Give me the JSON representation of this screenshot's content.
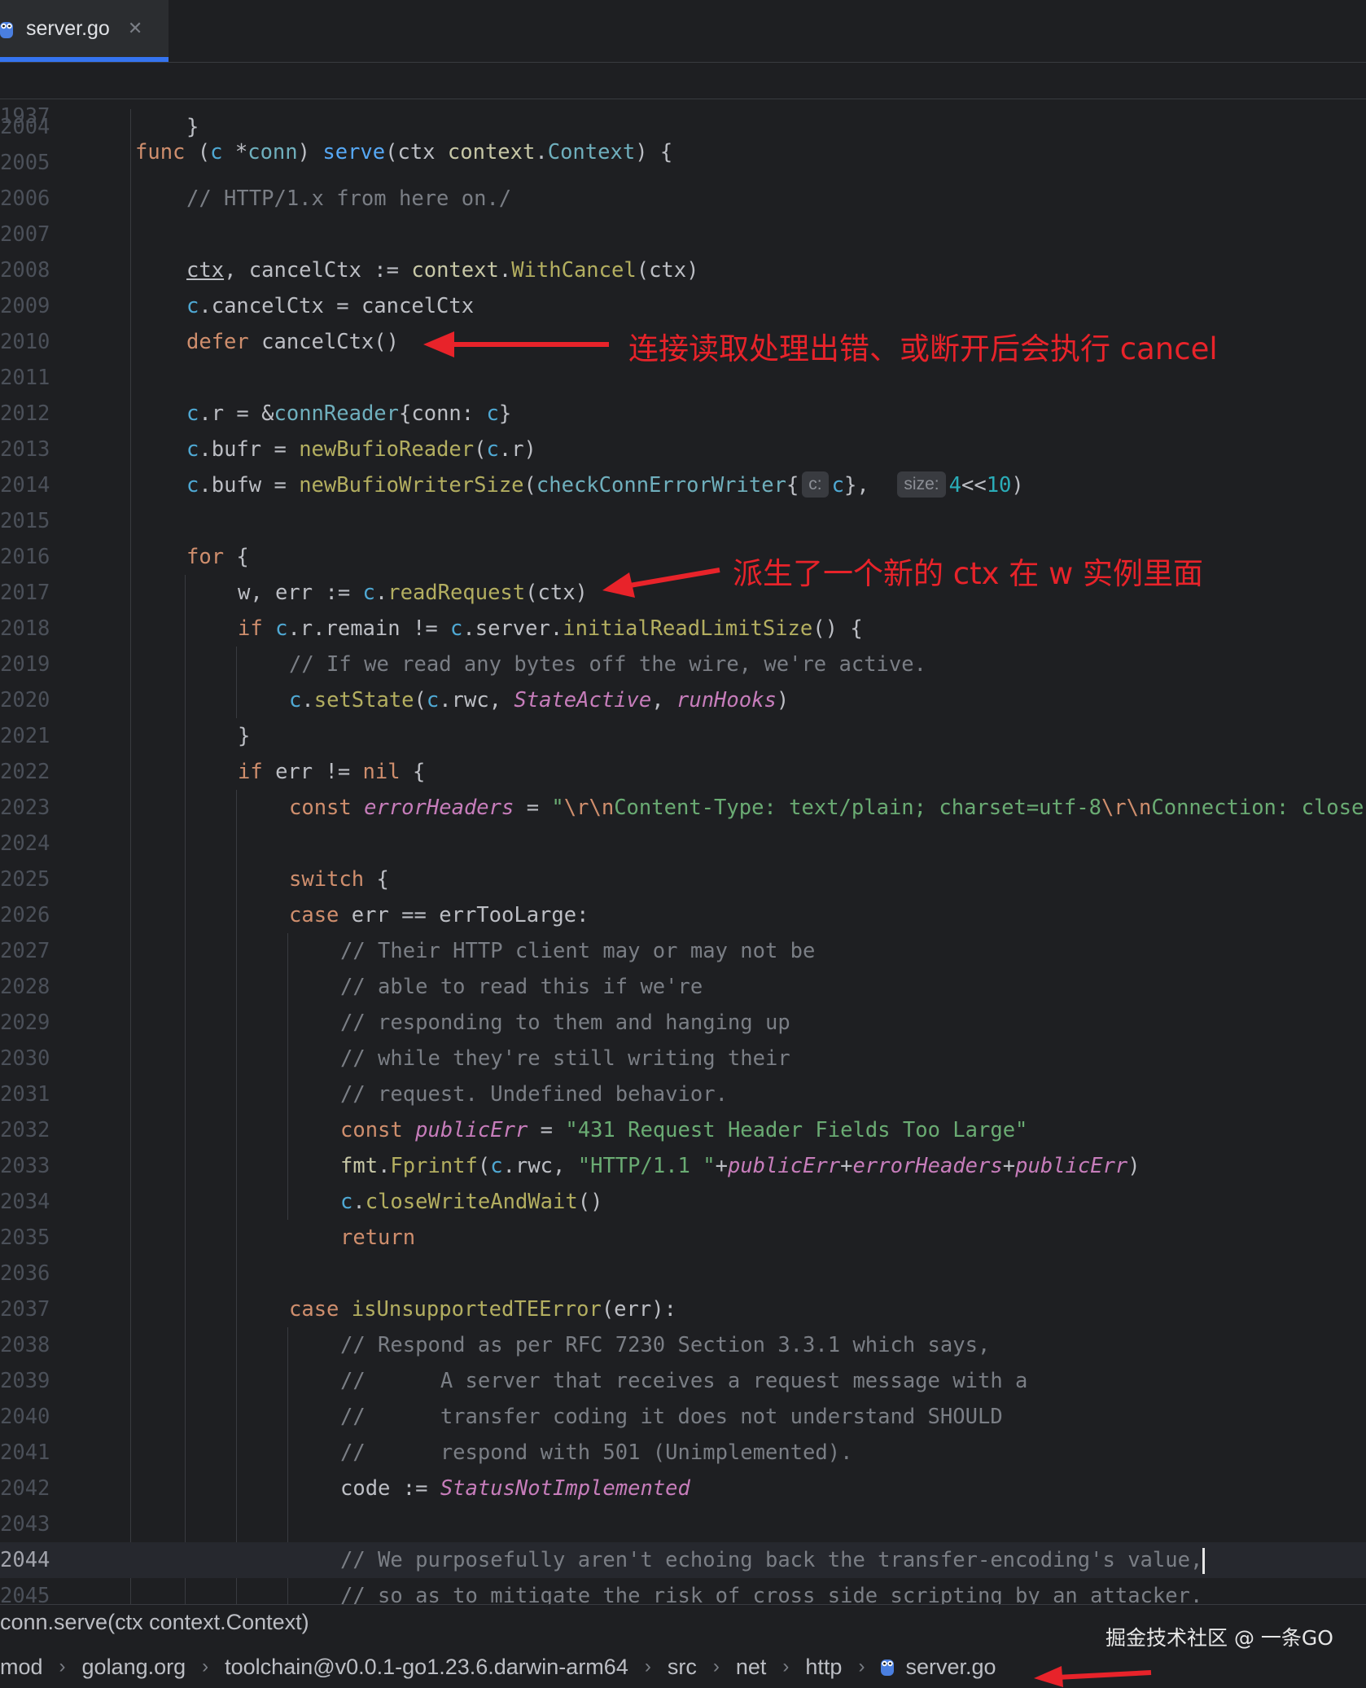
{
  "tab": {
    "label": "server.go",
    "close": "✕",
    "icon": "gopher-icon"
  },
  "sticky": {
    "line_number": "1937",
    "tokens": [
      {
        "t": "func",
        "c": "kw"
      },
      {
        "t": " (",
        "c": "typ"
      },
      {
        "t": "c",
        "c": "rcv"
      },
      {
        "t": " *",
        "c": "typ"
      },
      {
        "t": "conn",
        "c": "typn"
      },
      {
        "t": ") ",
        "c": "typ"
      },
      {
        "t": "serve",
        "c": "fn"
      },
      {
        "t": "(ctx ",
        "c": "typ"
      },
      {
        "t": "context",
        "c": "pkg"
      },
      {
        "t": ".",
        "c": "typ"
      },
      {
        "t": "Context",
        "c": "typn"
      },
      {
        "t": ") {",
        "c": "typ"
      }
    ]
  },
  "code_lines": [
    {
      "n": "2004",
      "indent": 1,
      "tokens": [
        {
          "t": "}",
          "c": "typ"
        }
      ]
    },
    {
      "n": "2005",
      "indent": 1,
      "tokens": []
    },
    {
      "n": "2006",
      "indent": 1,
      "tokens": [
        {
          "t": "// HTTP/1.x from here on./",
          "c": "cm"
        }
      ]
    },
    {
      "n": "2007",
      "indent": 1,
      "tokens": []
    },
    {
      "n": "2008",
      "indent": 1,
      "tokens": [
        {
          "t": "ctx",
          "c": "typ under"
        },
        {
          "t": ", cancelCtx := ",
          "c": "typ"
        },
        {
          "t": "context",
          "c": "pkg"
        },
        {
          "t": ".",
          "c": "typ"
        },
        {
          "t": "WithCancel",
          "c": "call"
        },
        {
          "t": "(ctx)",
          "c": "typ"
        }
      ]
    },
    {
      "n": "2009",
      "indent": 1,
      "tokens": [
        {
          "t": "c",
          "c": "rcv"
        },
        {
          "t": ".cancelCtx = cancelCtx",
          "c": "typ"
        }
      ]
    },
    {
      "n": "2010",
      "indent": 1,
      "tokens": [
        {
          "t": "defer",
          "c": "kw"
        },
        {
          "t": " cancelCtx()",
          "c": "typ"
        }
      ]
    },
    {
      "n": "2011",
      "indent": 1,
      "tokens": []
    },
    {
      "n": "2012",
      "indent": 1,
      "tokens": [
        {
          "t": "c",
          "c": "rcv"
        },
        {
          "t": ".r = &",
          "c": "typ"
        },
        {
          "t": "connReader",
          "c": "typn"
        },
        {
          "t": "{conn: ",
          "c": "typ"
        },
        {
          "t": "c",
          "c": "rcv"
        },
        {
          "t": "}",
          "c": "typ"
        }
      ]
    },
    {
      "n": "2013",
      "indent": 1,
      "tokens": [
        {
          "t": "c",
          "c": "rcv"
        },
        {
          "t": ".bufr = ",
          "c": "typ"
        },
        {
          "t": "newBufioReader",
          "c": "call"
        },
        {
          "t": "(",
          "c": "typ"
        },
        {
          "t": "c",
          "c": "rcv"
        },
        {
          "t": ".r)",
          "c": "typ"
        }
      ]
    },
    {
      "n": "2014",
      "indent": 1,
      "tokens": [
        {
          "t": "c",
          "c": "rcv"
        },
        {
          "t": ".bufw = ",
          "c": "typ"
        },
        {
          "t": "newBufioWriterSize",
          "c": "call"
        },
        {
          "t": "(",
          "c": "typ"
        },
        {
          "t": "checkConnErrorWriter",
          "c": "typn"
        },
        {
          "t": "{",
          "c": "typ"
        },
        {
          "t": "c:",
          "c": "hint"
        },
        {
          "t": "c",
          "c": "rcv"
        },
        {
          "t": "},  ",
          "c": "typ"
        },
        {
          "t": "size:",
          "c": "hint"
        },
        {
          "t": "4",
          "c": "num"
        },
        {
          "t": "<<",
          "c": "typ"
        },
        {
          "t": "10",
          "c": "num"
        },
        {
          "t": ")",
          "c": "typ"
        }
      ]
    },
    {
      "n": "2015",
      "indent": 1,
      "tokens": []
    },
    {
      "n": "2016",
      "indent": 1,
      "tokens": [
        {
          "t": "for",
          "c": "kw"
        },
        {
          "t": " {",
          "c": "typ"
        }
      ]
    },
    {
      "n": "2017",
      "indent": 2,
      "tokens": [
        {
          "t": "w, err := ",
          "c": "typ"
        },
        {
          "t": "c",
          "c": "rcv"
        },
        {
          "t": ".",
          "c": "typ"
        },
        {
          "t": "readRequest",
          "c": "call"
        },
        {
          "t": "(ctx)",
          "c": "typ"
        }
      ]
    },
    {
      "n": "2018",
      "indent": 2,
      "tokens": [
        {
          "t": "if",
          "c": "kw"
        },
        {
          "t": " ",
          "c": "typ"
        },
        {
          "t": "c",
          "c": "rcv"
        },
        {
          "t": ".r.remain != ",
          "c": "typ"
        },
        {
          "t": "c",
          "c": "rcv"
        },
        {
          "t": ".server.",
          "c": "typ"
        },
        {
          "t": "initialReadLimitSize",
          "c": "call"
        },
        {
          "t": "() {",
          "c": "typ"
        }
      ]
    },
    {
      "n": "2019",
      "indent": 3,
      "tokens": [
        {
          "t": "// If we read any bytes off the wire, we're active.",
          "c": "cm"
        }
      ]
    },
    {
      "n": "2020",
      "indent": 3,
      "tokens": [
        {
          "t": "c",
          "c": "rcv"
        },
        {
          "t": ".",
          "c": "typ"
        },
        {
          "t": "setState",
          "c": "call"
        },
        {
          "t": "(",
          "c": "typ"
        },
        {
          "t": "c",
          "c": "rcv"
        },
        {
          "t": ".rwc, ",
          "c": "typ"
        },
        {
          "t": "StateActive",
          "c": "it"
        },
        {
          "t": ", ",
          "c": "typ"
        },
        {
          "t": "runHooks",
          "c": "it"
        },
        {
          "t": ")",
          "c": "typ"
        }
      ]
    },
    {
      "n": "2021",
      "indent": 2,
      "tokens": [
        {
          "t": "}",
          "c": "typ"
        }
      ]
    },
    {
      "n": "2022",
      "indent": 2,
      "tokens": [
        {
          "t": "if",
          "c": "kw"
        },
        {
          "t": " err != ",
          "c": "typ"
        },
        {
          "t": "nil",
          "c": "kw"
        },
        {
          "t": " {",
          "c": "typ"
        }
      ]
    },
    {
      "n": "2023",
      "indent": 3,
      "tokens": [
        {
          "t": "const",
          "c": "kw"
        },
        {
          "t": " ",
          "c": "typ"
        },
        {
          "t": "errorHeaders",
          "c": "it"
        },
        {
          "t": " = ",
          "c": "typ"
        },
        {
          "t": "\"",
          "c": "str"
        },
        {
          "t": "\\r\\n",
          "c": "esc"
        },
        {
          "t": "Content-Type: text/plain; charset=utf-8",
          "c": "str"
        },
        {
          "t": "\\r\\n",
          "c": "esc"
        },
        {
          "t": "Connection: close",
          "c": "str"
        }
      ]
    },
    {
      "n": "2024",
      "indent": 3,
      "tokens": []
    },
    {
      "n": "2025",
      "indent": 3,
      "tokens": [
        {
          "t": "switch",
          "c": "kw"
        },
        {
          "t": " {",
          "c": "typ"
        }
      ]
    },
    {
      "n": "2026",
      "indent": 3,
      "tokens": [
        {
          "t": "case",
          "c": "kw"
        },
        {
          "t": " err == errTooLarge:",
          "c": "typ"
        }
      ]
    },
    {
      "n": "2027",
      "indent": 4,
      "tokens": [
        {
          "t": "// Their HTTP client may or may not be",
          "c": "cm"
        }
      ]
    },
    {
      "n": "2028",
      "indent": 4,
      "tokens": [
        {
          "t": "// able to read this if we're",
          "c": "cm"
        }
      ]
    },
    {
      "n": "2029",
      "indent": 4,
      "tokens": [
        {
          "t": "// responding to them and hanging up",
          "c": "cm"
        }
      ]
    },
    {
      "n": "2030",
      "indent": 4,
      "tokens": [
        {
          "t": "// while they're still writing their",
          "c": "cm"
        }
      ]
    },
    {
      "n": "2031",
      "indent": 4,
      "tokens": [
        {
          "t": "// request. Undefined behavior.",
          "c": "cm"
        }
      ]
    },
    {
      "n": "2032",
      "indent": 4,
      "tokens": [
        {
          "t": "const",
          "c": "kw"
        },
        {
          "t": " ",
          "c": "typ"
        },
        {
          "t": "publicErr",
          "c": "it"
        },
        {
          "t": " = ",
          "c": "typ"
        },
        {
          "t": "\"431 Request Header Fields Too Large\"",
          "c": "str"
        }
      ]
    },
    {
      "n": "2033",
      "indent": 4,
      "tokens": [
        {
          "t": "fmt",
          "c": "pkg"
        },
        {
          "t": ".",
          "c": "typ"
        },
        {
          "t": "Fprintf",
          "c": "call"
        },
        {
          "t": "(",
          "c": "typ"
        },
        {
          "t": "c",
          "c": "rcv"
        },
        {
          "t": ".rwc, ",
          "c": "typ"
        },
        {
          "t": "\"HTTP/1.1 \"",
          "c": "str"
        },
        {
          "t": "+",
          "c": "typ"
        },
        {
          "t": "publicErr",
          "c": "it"
        },
        {
          "t": "+",
          "c": "typ"
        },
        {
          "t": "errorHeaders",
          "c": "it"
        },
        {
          "t": "+",
          "c": "typ"
        },
        {
          "t": "publicErr",
          "c": "it"
        },
        {
          "t": ")",
          "c": "typ"
        }
      ]
    },
    {
      "n": "2034",
      "indent": 4,
      "tokens": [
        {
          "t": "c",
          "c": "rcv"
        },
        {
          "t": ".",
          "c": "typ"
        },
        {
          "t": "closeWriteAndWait",
          "c": "call"
        },
        {
          "t": "()",
          "c": "typ"
        }
      ]
    },
    {
      "n": "2035",
      "indent": 4,
      "tokens": [
        {
          "t": "return",
          "c": "kw"
        }
      ]
    },
    {
      "n": "2036",
      "indent": 3,
      "tokens": []
    },
    {
      "n": "2037",
      "indent": 3,
      "tokens": [
        {
          "t": "case",
          "c": "kw"
        },
        {
          "t": " ",
          "c": "typ"
        },
        {
          "t": "isUnsupportedTEError",
          "c": "call"
        },
        {
          "t": "(err):",
          "c": "typ"
        }
      ]
    },
    {
      "n": "2038",
      "indent": 4,
      "tokens": [
        {
          "t": "// Respond as per RFC 7230 Section 3.3.1 which says,",
          "c": "cm"
        }
      ]
    },
    {
      "n": "2039",
      "indent": 4,
      "tokens": [
        {
          "t": "//      A server that receives a request message with a",
          "c": "cm"
        }
      ]
    },
    {
      "n": "2040",
      "indent": 4,
      "tokens": [
        {
          "t": "//      transfer coding it does not understand SHOULD",
          "c": "cm"
        }
      ]
    },
    {
      "n": "2041",
      "indent": 4,
      "tokens": [
        {
          "t": "//      respond with 501 (Unimplemented).",
          "c": "cm"
        }
      ]
    },
    {
      "n": "2042",
      "indent": 4,
      "tokens": [
        {
          "t": "code := ",
          "c": "typ"
        },
        {
          "t": "StatusNotImplemented",
          "c": "it"
        }
      ]
    },
    {
      "n": "2043",
      "indent": 4,
      "tokens": []
    },
    {
      "n": "2044",
      "indent": 4,
      "current": true,
      "tokens": [
        {
          "t": "// We purposefully aren't echoing back the transfer-encoding's value,",
          "c": "cm"
        }
      ]
    },
    {
      "n": "2045",
      "indent": 4,
      "tokens": [
        {
          "t": "// so as to mitigate the risk of cross side scripting by an attacker.",
          "c": "cm"
        }
      ]
    }
  ],
  "annotations": {
    "cancel": "连接读取处理出错、或断开后会执行 cancel",
    "ctx": "派生了一个新的 ctx 在 w 实例里面"
  },
  "status": {
    "signature": "conn.serve(ctx context.Context)",
    "breadcrumbs": [
      "mod",
      "golang.org",
      "toolchain@v0.0.1-go1.23.6.darwin-arm64",
      "src",
      "net",
      "http",
      "server.go"
    ],
    "separator": "›"
  },
  "watermark": "掘金技术社区 @ 一条GO",
  "colors": {
    "annotation": "#e8232a",
    "accent": "#3574f0"
  }
}
